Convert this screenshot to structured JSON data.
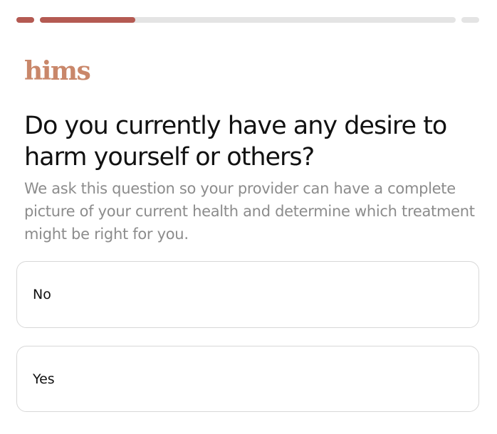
{
  "progress": {
    "segments": [
      {
        "fill": 1.0
      },
      {
        "fill": 0.23
      },
      {
        "fill": 0.0
      }
    ]
  },
  "brand": {
    "logo_text": "hims"
  },
  "question": {
    "title": "Do you currently have any desire to harm yourself or others?",
    "helper": "We ask this question so your provider can have a complete picture of your current health and determine which treatment might be right for you."
  },
  "options": [
    {
      "label": "No"
    },
    {
      "label": "Yes"
    }
  ],
  "colors": {
    "brand": "#c9876a",
    "progress_fill": "#b45a52",
    "progress_track": "#e4e4e4",
    "helper_text": "#8c8c8c",
    "border": "#d8d8d8"
  }
}
